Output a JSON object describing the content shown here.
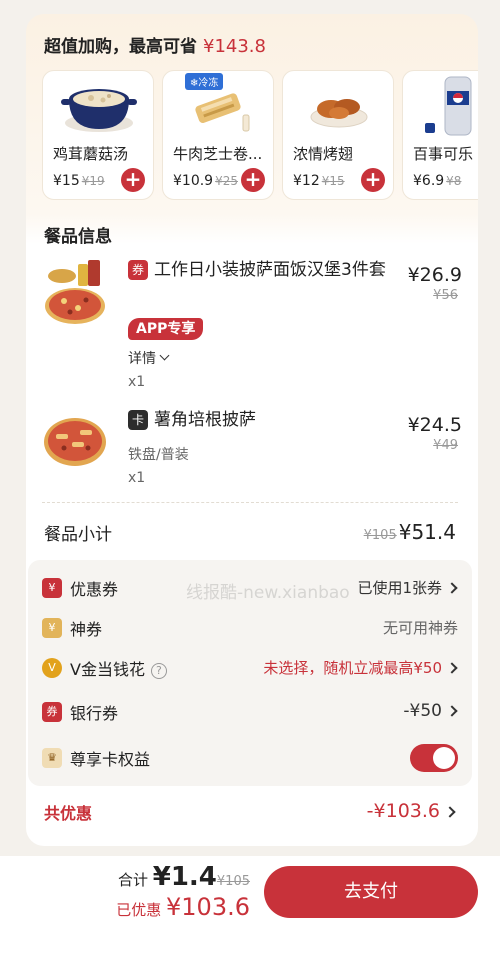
{
  "addon": {
    "title": "超值加购，最高可省",
    "amount": "¥143.8",
    "items": [
      {
        "name": "鸡茸蘑菇汤",
        "price": "¥15",
        "old": "¥19"
      },
      {
        "name": "牛肉芝士卷...",
        "price": "¥10.9",
        "old": "¥25",
        "tag": "冷冻"
      },
      {
        "name": "浓情烤翅",
        "price": "¥12",
        "old": "¥15"
      },
      {
        "name": "百事可乐",
        "price": "¥6.9",
        "old": "¥8"
      }
    ],
    "add_symbol": "+"
  },
  "meals": {
    "title": "餐品信息",
    "items": [
      {
        "badge": "券",
        "name": "工作日小装披萨面饭汉堡3件套",
        "price": "¥26.9",
        "old": "¥56",
        "tag": "APP专享",
        "detail": "详情",
        "qty": "x1"
      },
      {
        "badge": "卡",
        "name": "薯角培根披萨",
        "price": "¥24.5",
        "old": "¥49",
        "spec": "铁盘/普装",
        "qty": "x1"
      }
    ]
  },
  "subtotal": {
    "label": "餐品小计",
    "old": "¥105",
    "value": "¥51.4"
  },
  "discounts": [
    {
      "icon": "¥",
      "label": "优惠券",
      "value": "已使用1张券",
      "color": "#c8323a"
    },
    {
      "icon": "¥",
      "label": "神券",
      "value": "无可用神券",
      "color": "#e2b45a"
    },
    {
      "icon": "V",
      "label": "V金当钱花",
      "value": "未选择，随机立减最高¥50",
      "color": "#e2a21c"
    },
    {
      "icon": "券",
      "label": "银行券",
      "value": "-¥50",
      "color": "#c8323a"
    },
    {
      "icon": "♛",
      "label": "尊享卡权益",
      "value": "",
      "color": "#e8c98a"
    }
  ],
  "total_discount": {
    "label": "共优惠",
    "value": "-¥103.6"
  },
  "footer": {
    "total_label": "合计",
    "total_value": "¥1.4",
    "total_old": "¥105",
    "saved_label": "已优惠",
    "saved_value": "¥103.6",
    "pay_label": "去支付"
  },
  "watermark": "线报酷-new.xianbao"
}
